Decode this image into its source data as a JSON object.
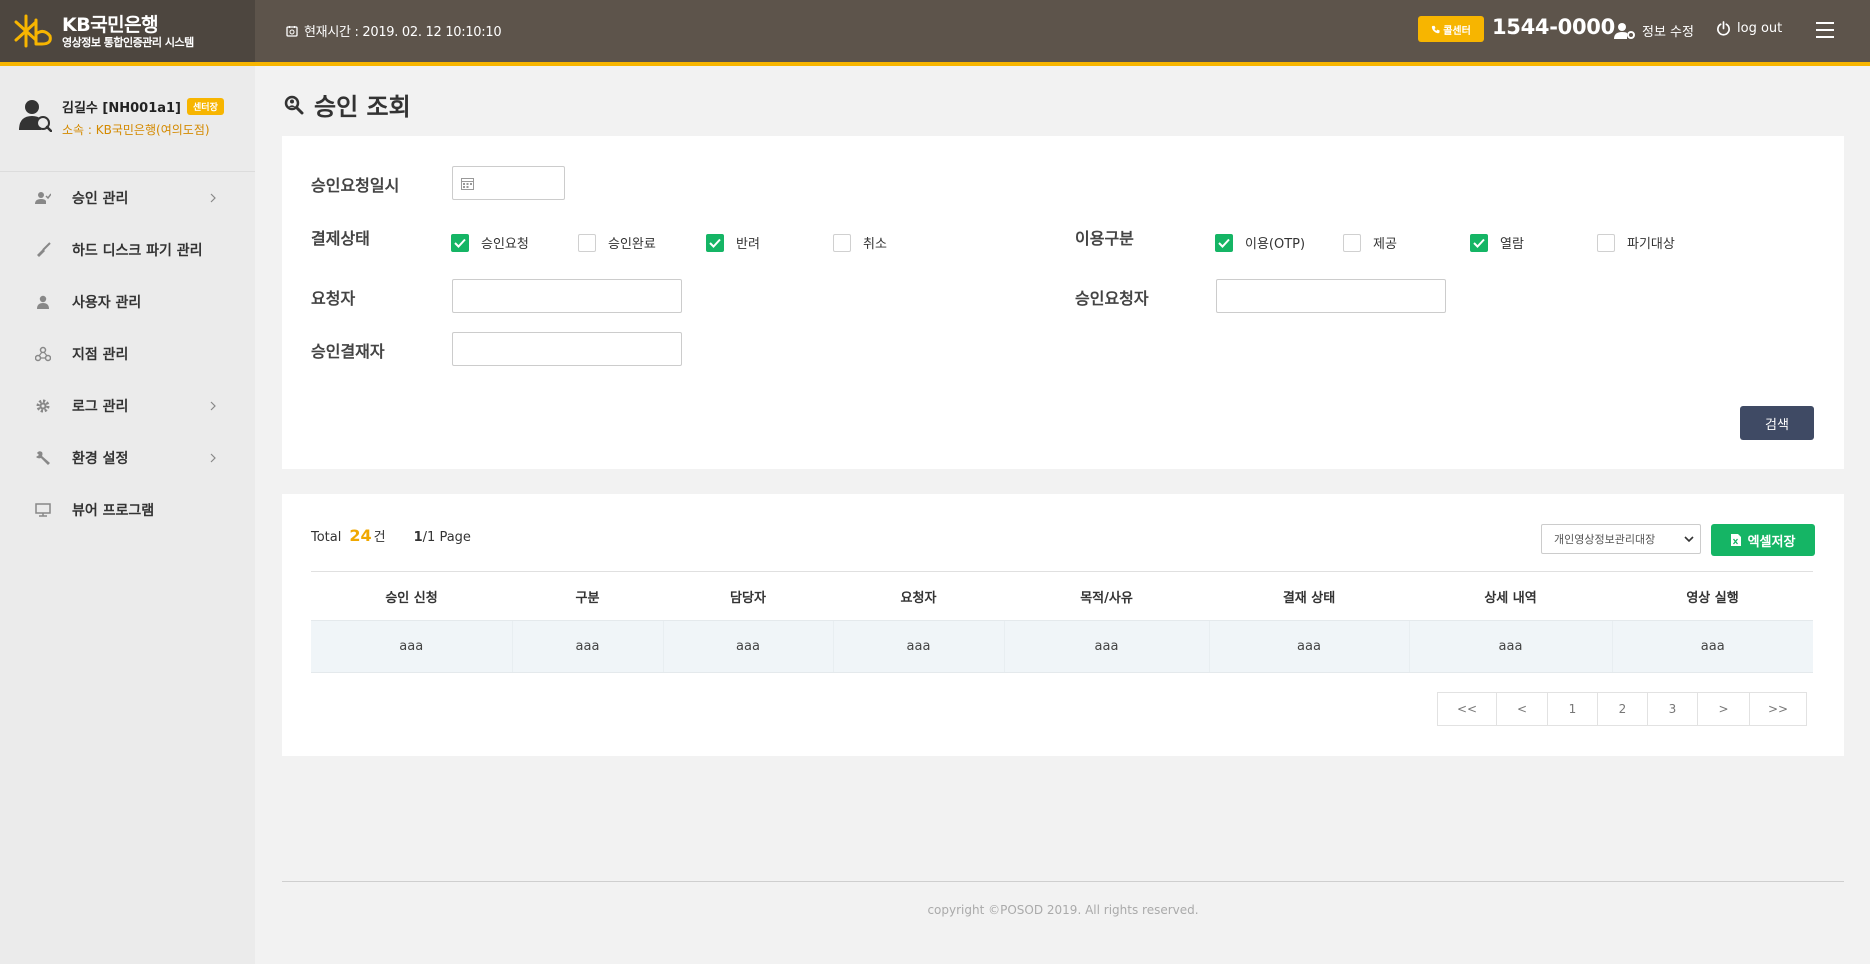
{
  "header": {
    "logo_name": "KB국민은행",
    "logo_subtitle": "영상정보 통합인증관리 시스템",
    "current_time": "현재시간 : 2019. 02. 12 10:10:10",
    "call_center_label": "콜센터",
    "call_number": "1544-0000",
    "edit_info_label": "정보 수정",
    "logout_label": "log out"
  },
  "profile": {
    "name": "김길수 [NH001a1]",
    "role": "센터장",
    "affiliation": "소속 : KB국민은행(여의도점)"
  },
  "sidebar": {
    "items": [
      {
        "label": "승인 관리",
        "icon": "user-check-icon",
        "has_submenu": true
      },
      {
        "label": "하드 디스크 파기 관리",
        "icon": "broom-icon",
        "has_submenu": false
      },
      {
        "label": "사용자 관리",
        "icon": "user-icon",
        "has_submenu": false
      },
      {
        "label": "지점 관리",
        "icon": "network-icon",
        "has_submenu": false
      },
      {
        "label": "로그 관리",
        "icon": "gear-icon",
        "has_submenu": true
      },
      {
        "label": "환경 설정",
        "icon": "wrench-icon",
        "has_submenu": true
      },
      {
        "label": "뷰어 프로그램",
        "icon": "monitor-icon",
        "has_submenu": false
      }
    ]
  },
  "page": {
    "title": "승인 조회"
  },
  "search": {
    "request_date_label": "승인요청일시",
    "status_label": "결제상태",
    "status_options": [
      {
        "label": "승인요청",
        "checked": true
      },
      {
        "label": "승인완료",
        "checked": false
      },
      {
        "label": "반려",
        "checked": true
      },
      {
        "label": "취소",
        "checked": false
      }
    ],
    "usage_label": "이용구분",
    "usage_options": [
      {
        "label": "이용(OTP)",
        "checked": true
      },
      {
        "label": "제공",
        "checked": false
      },
      {
        "label": "열람",
        "checked": true
      },
      {
        "label": "파기대상",
        "checked": false
      }
    ],
    "requester_label": "요청자",
    "approval_requester_label": "승인요청자",
    "approver_label": "승인결재자",
    "search_button": "검색"
  },
  "results": {
    "total_label": "Total",
    "total_count": "24",
    "count_unit": "건",
    "current_page": "1",
    "page_suffix": "/1 Page",
    "dropdown_selected": "개인영상정보관리대장",
    "excel_button": "엑셀저장",
    "columns": [
      "승인 신청",
      "구분",
      "담당자",
      "요청자",
      "목적/사유",
      "결재 상태",
      "상세 내역",
      "영상 실행"
    ],
    "rows": [
      [
        "aaa",
        "aaa",
        "aaa",
        "aaa",
        "aaa",
        "aaa",
        "aaa",
        "aaa"
      ]
    ],
    "pagination": [
      "<<",
      "<",
      "1",
      "2",
      "3",
      ">",
      ">>"
    ]
  },
  "footer": {
    "copyright": "copyright ©POSOD 2019. All rights reserved."
  },
  "colors": {
    "header_bg": "#5d544b",
    "accent_yellow": "#f7b500",
    "check_green": "#15b565",
    "search_button": "#3f4a64"
  }
}
